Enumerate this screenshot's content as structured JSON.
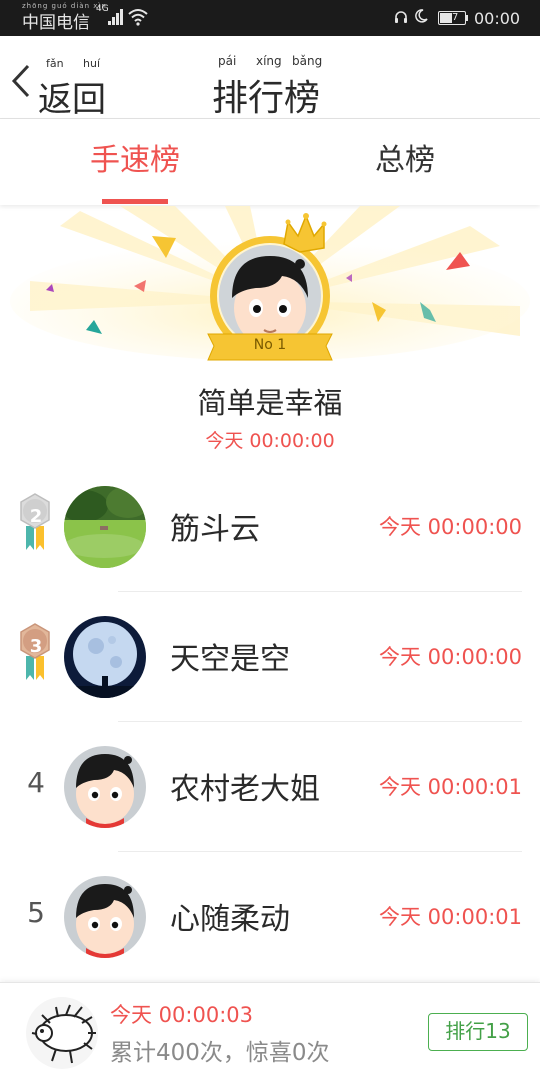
{
  "status_bar": {
    "carrier": "中国电信",
    "carrier_pinyin": "zhōng guó diàn xìn",
    "network": "4G",
    "battery": "47",
    "time": "00:00"
  },
  "header": {
    "back_label": "返回",
    "back_pinyin_1": "fǎn",
    "back_pinyin_2": "huí",
    "title": "排行榜",
    "title_pinyin_1": "pái",
    "title_pinyin_2": "xíng",
    "title_pinyin_3": "bǎng"
  },
  "tabs": [
    {
      "label": "手速榜",
      "active": true
    },
    {
      "label": "总榜",
      "active": false
    }
  ],
  "champion": {
    "badge": "No 1",
    "name": "简单是幸福",
    "time": "今天 00:00:00"
  },
  "ranking": [
    {
      "rank": "2",
      "name": "筋斗云",
      "time": "今天 00:00:00",
      "avatar": "landscape"
    },
    {
      "rank": "3",
      "name": "天空是空",
      "time": "今天 00:00:00",
      "avatar": "moon"
    },
    {
      "rank": "4",
      "name": "农村老大姐",
      "time": "今天 00:00:01",
      "avatar": "cartoon"
    },
    {
      "rank": "5",
      "name": "心随柔动",
      "time": "今天 00:00:01",
      "avatar": "cartoon"
    }
  ],
  "me": {
    "time": "今天 00:00:03",
    "stats": "累计400次，惊喜0次",
    "rank_button": "排行13"
  },
  "colors": {
    "accent": "#ef5350",
    "green": "#43a047",
    "gold": "#f6c533",
    "statusbar": "#1b1b1b"
  }
}
